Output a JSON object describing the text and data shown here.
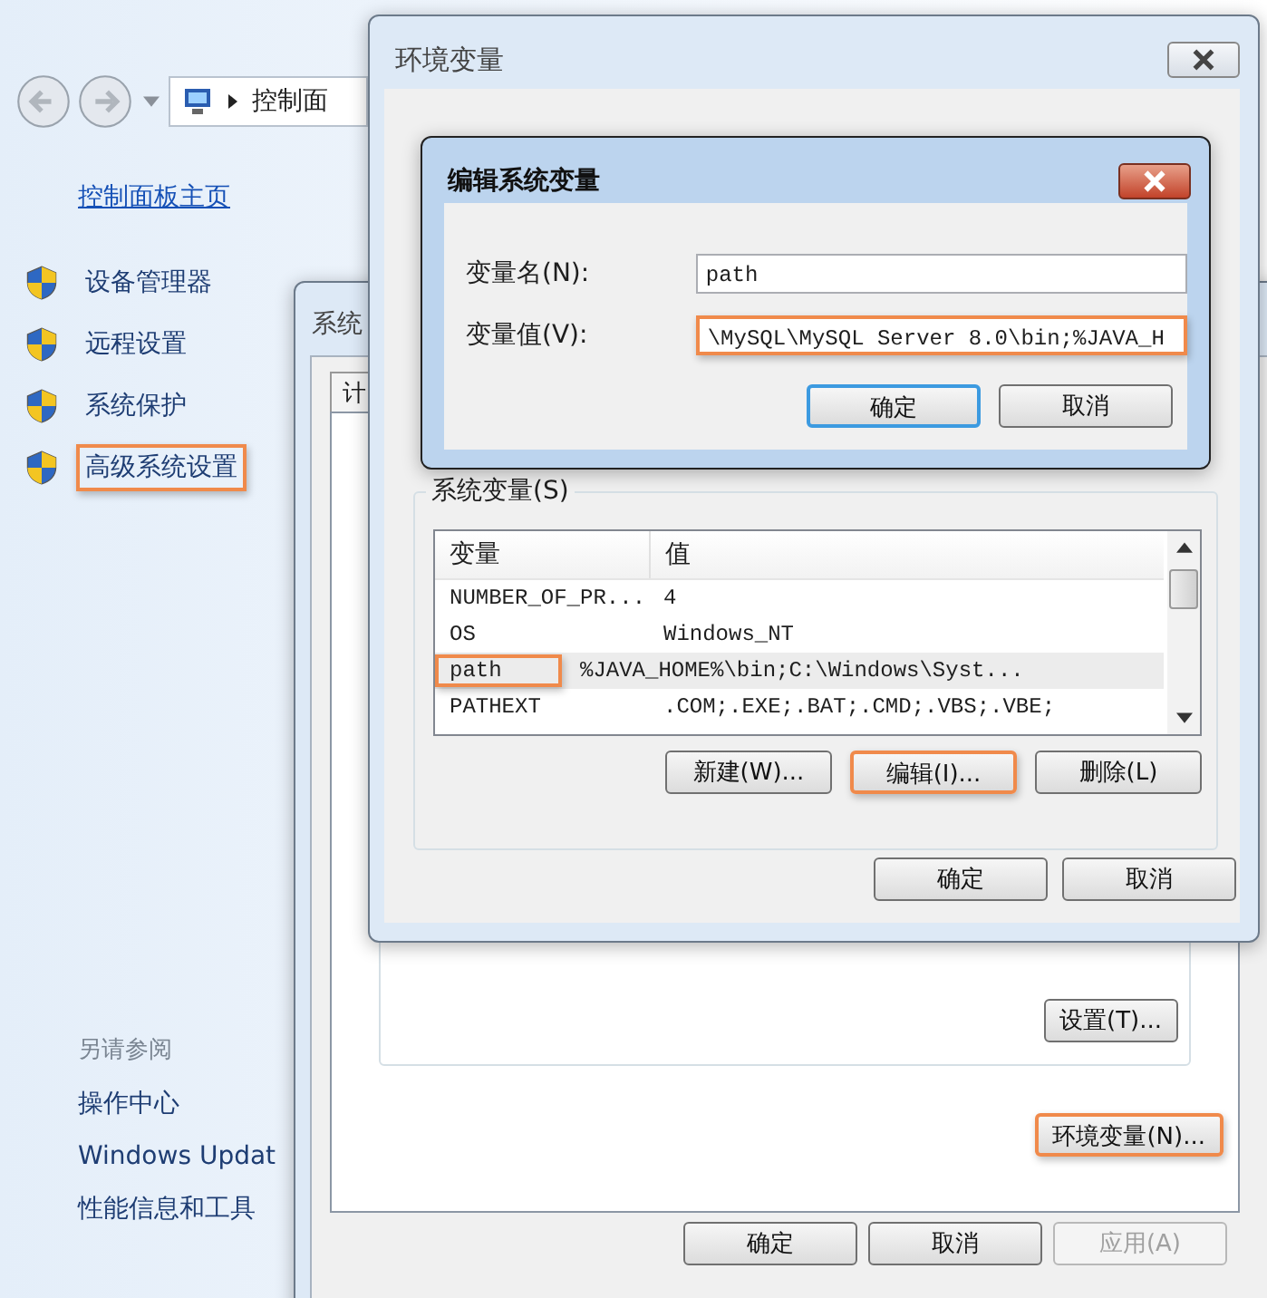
{
  "control_panel": {
    "breadcrumb": "控制面",
    "home_link": "控制面板主页",
    "tasks": [
      {
        "label": "设备管理器",
        "highlighted": false
      },
      {
        "label": "远程设置",
        "highlighted": false
      },
      {
        "label": "系统保护",
        "highlighted": false
      },
      {
        "label": "高级系统设置",
        "highlighted": true
      }
    ],
    "see_also": {
      "heading": "另请参阅",
      "links": [
        "操作中心",
        "Windows Updat",
        "性能信息和工具"
      ]
    }
  },
  "system_properties": {
    "title": "系统",
    "tab": "计",
    "settings_button": "设置(T)...",
    "env_button": {
      "label": "环境变量(N)...",
      "highlighted": true
    },
    "buttons": [
      {
        "label": "确定",
        "disabled": false
      },
      {
        "label": "取消",
        "disabled": false
      },
      {
        "label": "应用(A)",
        "disabled": true
      }
    ]
  },
  "env_vars": {
    "title": "环境变量",
    "group_label": "系统变量(S)",
    "columns": [
      "变量",
      "值"
    ],
    "rows": [
      {
        "name": "NUMBER_OF_PR...",
        "value": "4",
        "selected": false,
        "highlighted": false
      },
      {
        "name": "OS",
        "value": "Windows_NT",
        "selected": false,
        "highlighted": false
      },
      {
        "name": "path",
        "value": "%JAVA_HOME%\\bin;C:\\Windows\\Syst...",
        "selected": true,
        "highlighted": true
      },
      {
        "name": "PATHEXT",
        "value": ".COM;.EXE;.BAT;.CMD;.VBS;.VBE;",
        "selected": false,
        "highlighted": false
      }
    ],
    "actions": [
      {
        "label": "新建(W)...",
        "highlighted": false
      },
      {
        "label": "编辑(I)...",
        "highlighted": true
      },
      {
        "label": "删除(L)",
        "highlighted": false
      }
    ],
    "buttons": [
      "确定",
      "取消"
    ]
  },
  "edit_dialog": {
    "title": "编辑系统变量",
    "fields": [
      {
        "label": "变量名(N):",
        "value": "path",
        "highlighted": false
      },
      {
        "label": "变量值(V):",
        "value": "\\MySQL\\MySQL Server 8.0\\bin;%JAVA_H",
        "highlighted": true
      }
    ],
    "buttons": [
      {
        "label": "确定",
        "default": true
      },
      {
        "label": "取消",
        "default": false
      }
    ]
  }
}
